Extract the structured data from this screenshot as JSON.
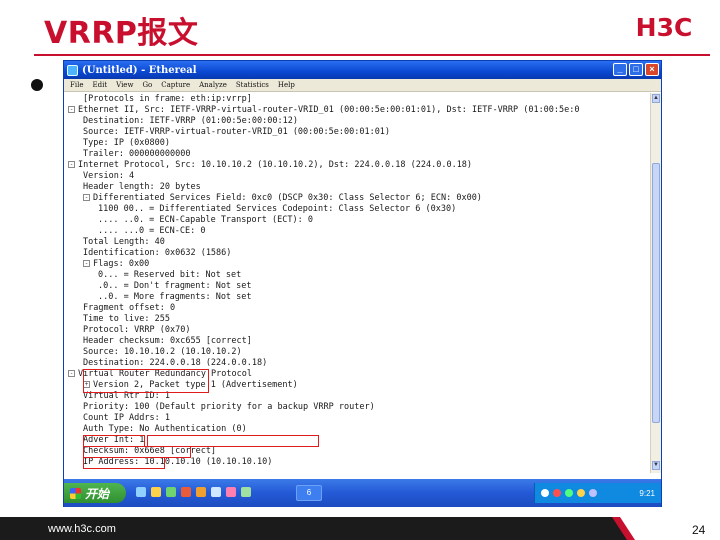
{
  "slide": {
    "title": "VRRP报文",
    "logo_text": "H3C",
    "footer_url": "www.h3c.com",
    "page_number": "24",
    "accent_color": "#c8102e"
  },
  "window": {
    "title": "(Untitled) - Ethereal",
    "controls": {
      "minimize": "_",
      "maximize": "□",
      "close": "×"
    },
    "menu": [
      "File",
      "Edit",
      "View",
      "Go",
      "Capture",
      "Analyze",
      "Statistics",
      "Help"
    ]
  },
  "packet_tree": [
    {
      "indent": 1,
      "expander": "",
      "text": "[Protocols in frame: eth:ip:vrrp]"
    },
    {
      "indent": 0,
      "expander": "-",
      "text": "Ethernet II, Src: IETF-VRRP-virtual-router-VRID_01 (00:00:5e:00:01:01), Dst: IETF-VRRP (01:00:5e:0"
    },
    {
      "indent": 1,
      "expander": "",
      "text": "Destination: IETF-VRRP (01:00:5e:00:00:12)"
    },
    {
      "indent": 1,
      "expander": "",
      "text": "Source: IETF-VRRP-virtual-router-VRID_01 (00:00:5e:00:01:01)"
    },
    {
      "indent": 1,
      "expander": "",
      "text": "Type: IP (0x0800)"
    },
    {
      "indent": 1,
      "expander": "",
      "text": "Trailer: 000000000000"
    },
    {
      "indent": 0,
      "expander": "-",
      "text": "Internet Protocol, Src: 10.10.10.2 (10.10.10.2), Dst: 224.0.0.18 (224.0.0.18)"
    },
    {
      "indent": 1,
      "expander": "",
      "text": "Version: 4"
    },
    {
      "indent": 1,
      "expander": "",
      "text": "Header length: 20 bytes"
    },
    {
      "indent": 1,
      "expander": "-",
      "text": "Differentiated Services Field: 0xc0 (DSCP 0x30: Class Selector 6; ECN: 0x00)"
    },
    {
      "indent": 2,
      "expander": "",
      "text": "1100 00.. = Differentiated Services Codepoint: Class Selector 6 (0x30)"
    },
    {
      "indent": 2,
      "expander": "",
      "text": ".... ..0. = ECN-Capable Transport (ECT): 0"
    },
    {
      "indent": 2,
      "expander": "",
      "text": ".... ...0 = ECN-CE: 0"
    },
    {
      "indent": 1,
      "expander": "",
      "text": "Total Length: 40"
    },
    {
      "indent": 1,
      "expander": "",
      "text": "Identification: 0x0632 (1586)"
    },
    {
      "indent": 1,
      "expander": "-",
      "text": "Flags: 0x00"
    },
    {
      "indent": 2,
      "expander": "",
      "text": "0... = Reserved bit: Not set"
    },
    {
      "indent": 2,
      "expander": "",
      "text": ".0.. = Don't fragment: Not set"
    },
    {
      "indent": 2,
      "expander": "",
      "text": "..0. = More fragments: Not set"
    },
    {
      "indent": 1,
      "expander": "",
      "text": "Fragment offset: 0"
    },
    {
      "indent": 1,
      "expander": "",
      "text": "Time to live: 255"
    },
    {
      "indent": 1,
      "expander": "",
      "text": "Protocol: VRRP (0x70)"
    },
    {
      "indent": 1,
      "expander": "",
      "text": "Header checksum: 0xc655 [correct]"
    },
    {
      "indent": 1,
      "expander": "",
      "text": "Source: 10.10.10.2 (10.10.10.2)"
    },
    {
      "indent": 1,
      "expander": "",
      "text": "Destination: 224.0.0.18 (224.0.0.18)"
    },
    {
      "indent": 0,
      "expander": "-",
      "text": "Virtual Router Redundancy Protocol"
    },
    {
      "indent": 1,
      "expander": "+",
      "text": "Version 2, Packet type 1 (Advertisement)"
    },
    {
      "indent": 1,
      "expander": "",
      "text": "Virtual Rtr ID: 1"
    },
    {
      "indent": 1,
      "expander": "",
      "text": "Priority: 100 (Default priority for a backup VRRP router)"
    },
    {
      "indent": 1,
      "expander": "",
      "text": "Count IP Addrs: 1"
    },
    {
      "indent": 1,
      "expander": "",
      "text": "Auth Type: No Authentication (0)"
    },
    {
      "indent": 1,
      "expander": "",
      "text": "Adver Int: 1"
    },
    {
      "indent": 1,
      "expander": "",
      "text": "Checksum: 0x66e8 [correct]"
    },
    {
      "indent": 1,
      "expander": "",
      "text": "IP Address: 10.10.10.10 (10.10.10.10)"
    }
  ],
  "taskbar": {
    "start_label": "开始",
    "task_label": "6",
    "clock": "9:21",
    "colors": {
      "start": "#3a9e3a",
      "bar": "#2459d6",
      "tray": "#0f8ae0"
    }
  }
}
